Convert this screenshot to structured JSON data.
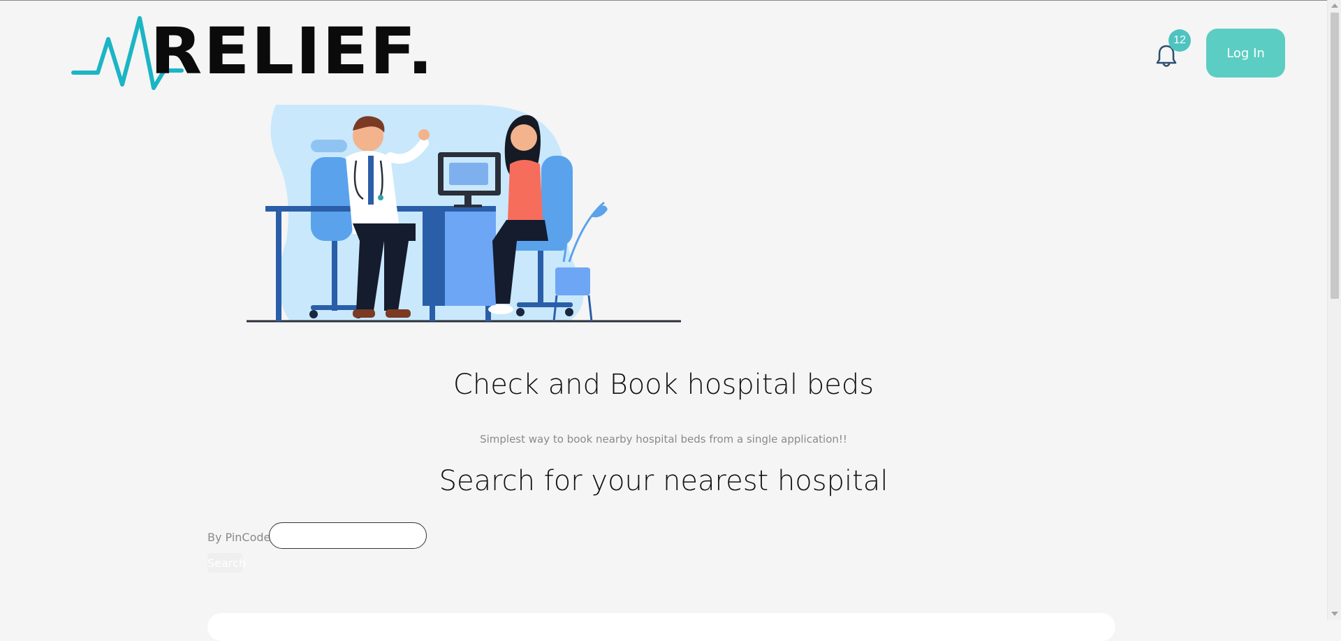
{
  "header": {
    "logo_text": "RELIEF.",
    "notification_count": "12",
    "login_label": "Log In"
  },
  "hero": {
    "title": "Check and Book hospital beds",
    "subtitle": "Simplest way to book nearby hospital beds from a single application!!"
  },
  "search": {
    "title": "Search for your nearest hospital",
    "pincode_label": "By PinCode",
    "pincode_value": "",
    "button_label": "Search"
  },
  "colors": {
    "accent": "#5ccdc2",
    "badge": "#4fc3c0",
    "logo_pulse": "#1bb5c4",
    "background": "#f5f5f5"
  },
  "icons": {
    "bell": "bell-icon",
    "pulse": "heartbeat-icon"
  }
}
